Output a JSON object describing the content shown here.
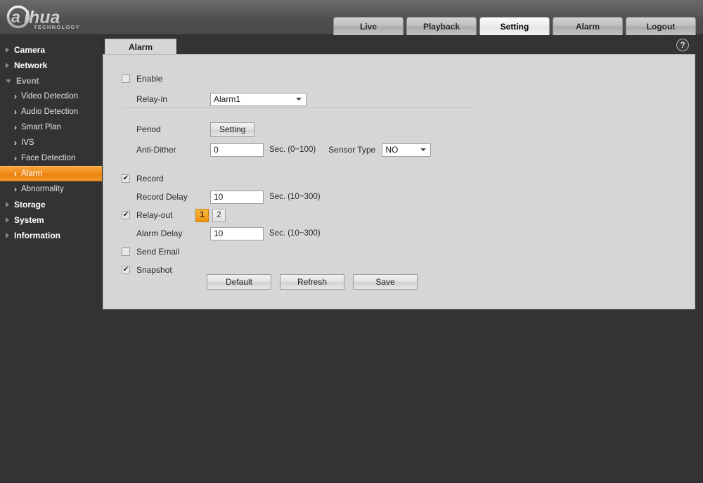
{
  "brand": {
    "name": "alhua",
    "tagline": "TECHNOLOGY"
  },
  "topnav": {
    "items": [
      {
        "label": "Live",
        "active": false
      },
      {
        "label": "Playback",
        "active": false
      },
      {
        "label": "Setting",
        "active": true
      },
      {
        "label": "Alarm",
        "active": false
      },
      {
        "label": "Logout",
        "active": false
      }
    ]
  },
  "sidebar": {
    "items": [
      {
        "label": "Camera",
        "level": "top",
        "state": "collapsed"
      },
      {
        "label": "Network",
        "level": "top",
        "state": "collapsed"
      },
      {
        "label": "Event",
        "level": "top",
        "state": "expanded"
      },
      {
        "label": "Video Detection",
        "level": "sub",
        "selected": false
      },
      {
        "label": "Audio Detection",
        "level": "sub",
        "selected": false
      },
      {
        "label": "Smart Plan",
        "level": "sub",
        "selected": false
      },
      {
        "label": "IVS",
        "level": "sub",
        "selected": false
      },
      {
        "label": "Face Detection",
        "level": "sub",
        "selected": false
      },
      {
        "label": "Alarm",
        "level": "sub",
        "selected": true
      },
      {
        "label": "Abnormality",
        "level": "sub",
        "selected": false
      },
      {
        "label": "Storage",
        "level": "top",
        "state": "collapsed"
      },
      {
        "label": "System",
        "level": "top",
        "state": "collapsed"
      },
      {
        "label": "Information",
        "level": "top",
        "state": "collapsed"
      }
    ]
  },
  "content": {
    "tab_label": "Alarm",
    "help_icon": "question-mark-icon"
  },
  "form": {
    "enable": {
      "label": "Enable",
      "checked": false
    },
    "relay_in": {
      "label": "Relay-in",
      "value": "Alarm1"
    },
    "period": {
      "label": "Period",
      "button": "Setting"
    },
    "anti_dither": {
      "label": "Anti-Dither",
      "value": "0",
      "unit": "Sec. (0~100)"
    },
    "sensor_type": {
      "label": "Sensor Type",
      "value": "NO"
    },
    "record": {
      "label": "Record",
      "checked": true
    },
    "record_delay": {
      "label": "Record Delay",
      "value": "10",
      "unit": "Sec. (10~300)"
    },
    "relay_out": {
      "label": "Relay-out",
      "checked": true,
      "buttons": [
        "1",
        "2"
      ],
      "active_index": 0
    },
    "alarm_delay": {
      "label": "Alarm Delay",
      "value": "10",
      "unit": "Sec. (10~300)"
    },
    "send_email": {
      "label": "Send Email",
      "checked": false
    },
    "snapshot": {
      "label": "Snapshot",
      "checked": true
    },
    "actions": {
      "default": "Default",
      "refresh": "Refresh",
      "save": "Save"
    }
  },
  "colors": {
    "accent_orange": "#f0920f",
    "header_gray": "#575757",
    "panel_gray": "#d6d6d6",
    "page_dark": "#333333"
  }
}
